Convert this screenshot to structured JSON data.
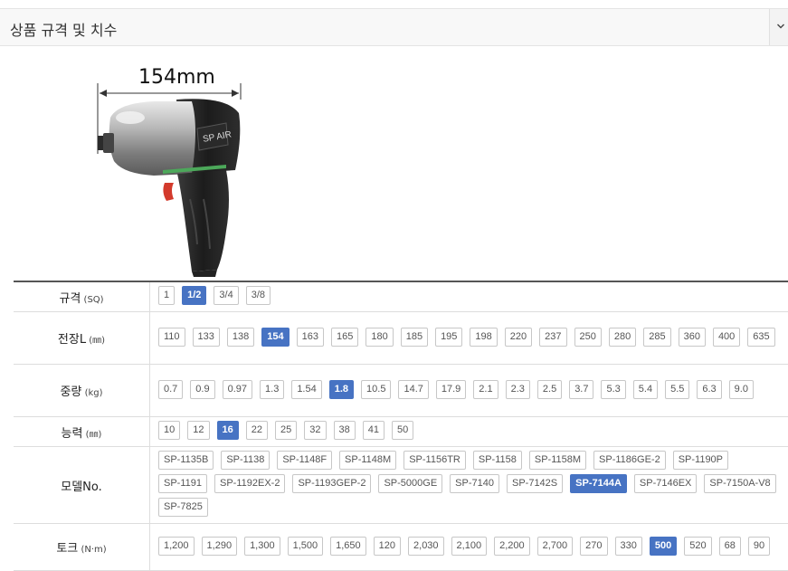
{
  "header": {
    "title": "상품 규격 및 치수",
    "toggle_icon": "chevron-down-icon"
  },
  "product_image": {
    "dimension_label": "154mm",
    "brand_text": "SP AIR"
  },
  "colors": {
    "selected": "#4773c3",
    "chip_border": "#c7c7c7"
  },
  "spec_rows": [
    {
      "label": "규격",
      "unit": "(SQ)",
      "options": [
        "1",
        "1/2",
        "3/4",
        "3/8"
      ],
      "selected": "1/2"
    },
    {
      "label": "전장L",
      "unit": "(㎜)",
      "options": [
        "110",
        "133",
        "138",
        "154",
        "163",
        "165",
        "180",
        "185",
        "195",
        "198",
        "220",
        "237",
        "250",
        "280",
        "285",
        "360",
        "400",
        "635"
      ],
      "selected": "154"
    },
    {
      "label": "중량",
      "unit": "(kg)",
      "options": [
        "0.7",
        "0.9",
        "0.97",
        "1.3",
        "1.54",
        "1.8",
        "10.5",
        "14.7",
        "17.9",
        "2.1",
        "2.3",
        "2.5",
        "3.7",
        "5.3",
        "5.4",
        "5.5",
        "6.3",
        "9.0"
      ],
      "selected": "1.8"
    },
    {
      "label": "능력",
      "unit": "(㎜)",
      "options": [
        "10",
        "12",
        "16",
        "22",
        "25",
        "32",
        "38",
        "41",
        "50"
      ],
      "selected": "16"
    },
    {
      "label": "모델No.",
      "unit": "",
      "options": [
        "SP-1135B",
        "SP-1138",
        "SP-1148F",
        "SP-1148M",
        "SP-1156TR",
        "SP-1158",
        "SP-1158M",
        "SP-1186GE-2",
        "SP-1190P",
        "SP-1191",
        "SP-1192EX-2",
        "SP-1193GEP-2",
        "SP-5000GE",
        "SP-7140",
        "SP-7142S",
        "SP-7144A",
        "SP-7146EX",
        "SP-7150A-V8",
        "SP-7825"
      ],
      "selected": "SP-7144A"
    },
    {
      "label": "토크",
      "unit": "(N·m)",
      "options": [
        "1,200",
        "1,290",
        "1,300",
        "1,500",
        "1,650",
        "120",
        "2,030",
        "2,100",
        "2,200",
        "2,700",
        "270",
        "330",
        "500",
        "520",
        "68",
        "90"
      ],
      "selected": "500"
    }
  ]
}
